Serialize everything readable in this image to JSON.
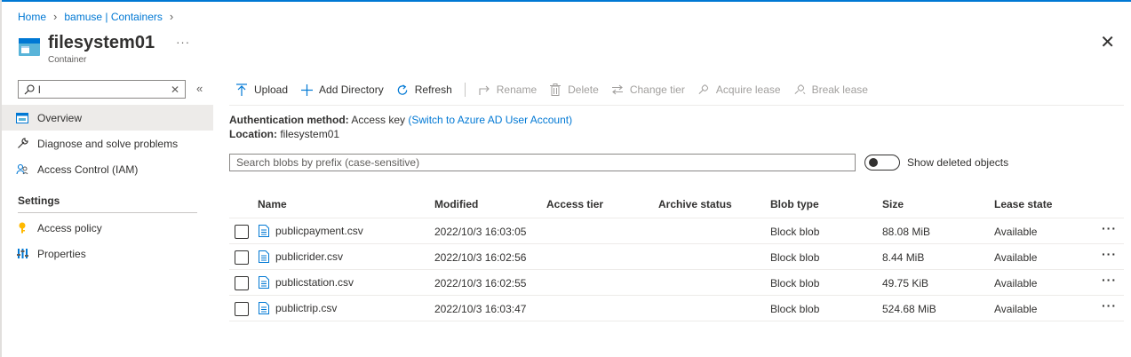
{
  "breadcrumb": {
    "home": "Home",
    "account": "bamuse | Containers"
  },
  "header": {
    "title": "filesystem01",
    "subtitle": "Container",
    "more": "···",
    "close": "✕"
  },
  "left": {
    "search_value": "l",
    "search_clear": "✕",
    "collapse": "«",
    "items": [
      {
        "label": "Overview",
        "icon": "overview-icon"
      },
      {
        "label": "Diagnose and solve problems",
        "icon": "wrench-icon"
      },
      {
        "label": "Access Control (IAM)",
        "icon": "people-icon"
      }
    ],
    "settings_heading": "Settings",
    "settings_items": [
      {
        "label": "Access policy",
        "icon": "key-icon"
      },
      {
        "label": "Properties",
        "icon": "properties-icon"
      }
    ]
  },
  "toolbar": {
    "upload": "Upload",
    "add_directory": "Add Directory",
    "refresh": "Refresh",
    "rename": "Rename",
    "delete": "Delete",
    "change_tier": "Change tier",
    "acquire_lease": "Acquire lease",
    "break_lease": "Break lease"
  },
  "info": {
    "auth_label": "Authentication method:",
    "auth_value": "Access key",
    "auth_link": "(Switch to Azure AD User Account)",
    "location_label": "Location:",
    "location_value": "filesystem01"
  },
  "blob_search": {
    "placeholder": "Search blobs by prefix (case-sensitive)"
  },
  "show_deleted": {
    "label": "Show deleted objects",
    "on": false
  },
  "table": {
    "columns": {
      "name": "Name",
      "modified": "Modified",
      "access_tier": "Access tier",
      "archive_status": "Archive status",
      "blob_type": "Blob type",
      "size": "Size",
      "lease_state": "Lease state"
    },
    "rows": [
      {
        "name": "publicpayment.csv",
        "modified": "2022/10/3 16:03:05",
        "blob_type": "Block blob",
        "size": "88.08 MiB",
        "lease_state": "Available",
        "more": "···"
      },
      {
        "name": "publicrider.csv",
        "modified": "2022/10/3 16:02:56",
        "blob_type": "Block blob",
        "size": "8.44 MiB",
        "lease_state": "Available",
        "more": "···"
      },
      {
        "name": "publicstation.csv",
        "modified": "2022/10/3 16:02:55",
        "blob_type": "Block blob",
        "size": "49.75 KiB",
        "lease_state": "Available",
        "more": "···"
      },
      {
        "name": "publictrip.csv",
        "modified": "2022/10/3 16:03:47",
        "blob_type": "Block blob",
        "size": "524.68 MiB",
        "lease_state": "Available",
        "more": "···"
      }
    ]
  },
  "colors": {
    "accent": "#0078d4",
    "text": "#323130",
    "disabled": "#a19f9d",
    "selected_bg": "#edebe9"
  }
}
